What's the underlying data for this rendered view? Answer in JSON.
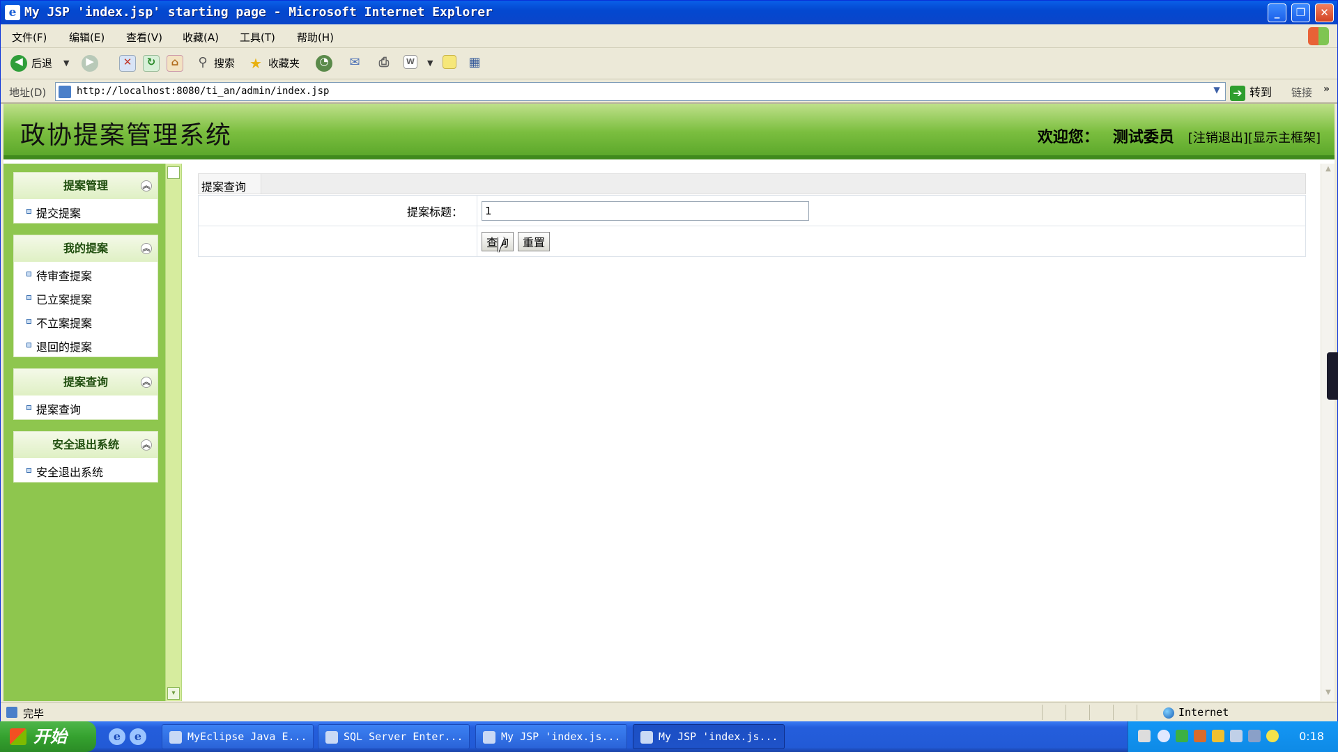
{
  "window": {
    "title": "My JSP 'index.jsp' starting page - Microsoft Internet Explorer"
  },
  "menu": [
    "文件(F)",
    "编辑(E)",
    "查看(V)",
    "收藏(A)",
    "工具(T)",
    "帮助(H)"
  ],
  "toolbar": {
    "back": "后退",
    "search": "搜索",
    "favorites": "收藏夹"
  },
  "address": {
    "label": "地址(D)",
    "url": "http://localhost:8080/ti_an/admin/index.jsp",
    "go": "转到",
    "links": "链接"
  },
  "header": {
    "system_name": "政协提案管理系统",
    "welcome_label": "欢迎您：",
    "user": "测试委员",
    "logout": "[注销退出]",
    "show_frame": "[显示主框架]"
  },
  "sidebar": {
    "groups": [
      {
        "title": "提案管理",
        "items": [
          "提交提案"
        ]
      },
      {
        "title": "我的提案",
        "items": [
          "待审查提案",
          "已立案提案",
          "不立案提案",
          "退回的提案"
        ]
      },
      {
        "title": "提案查询",
        "items": [
          "提案查询"
        ]
      },
      {
        "title": "安全退出系统",
        "items": [
          "安全退出系统"
        ]
      }
    ]
  },
  "content": {
    "breadcrumb": "提案查询",
    "form": {
      "title_label": "提案标题：",
      "title_value": "1",
      "query_button": "查询",
      "reset_button": "重置"
    }
  },
  "statusbar": {
    "status": "完毕",
    "zone": "Internet"
  },
  "taskbar": {
    "start": "开始",
    "tasks": [
      "MyEclipse Java E...",
      "SQL Server Enter...",
      "My JSP 'index.js...",
      "My JSP 'index.js..."
    ],
    "active_index": 3,
    "clock": "0:18"
  }
}
